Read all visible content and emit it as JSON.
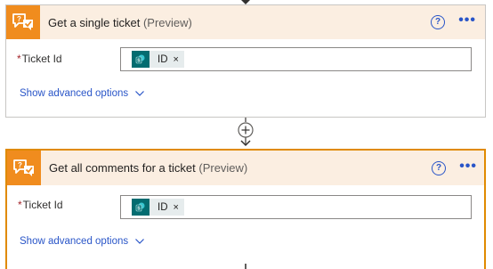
{
  "flow": {
    "actions": [
      {
        "title": "Get a single ticket",
        "preview": "(Preview)",
        "help_icon": "?",
        "more_icon": "•••",
        "field_label": "Ticket Id",
        "required_mark": "*",
        "token_label": "ID",
        "token_remove": "×",
        "advanced_label": "Show advanced options",
        "selected": false
      },
      {
        "title": "Get all comments for a ticket",
        "preview": "(Preview)",
        "help_icon": "?",
        "more_icon": "•••",
        "field_label": "Ticket Id",
        "required_mark": "*",
        "token_label": "ID",
        "token_remove": "×",
        "advanced_label": "Show advanced options",
        "selected": true
      }
    ],
    "add_step_icon": "plus-icon"
  },
  "colors": {
    "header_bg": "#fbeee1",
    "app_icon_bg": "#f08c1e",
    "selected_border": "#e08a00",
    "link_blue": "#2955c8",
    "token_icon_bg": "#036c70"
  }
}
